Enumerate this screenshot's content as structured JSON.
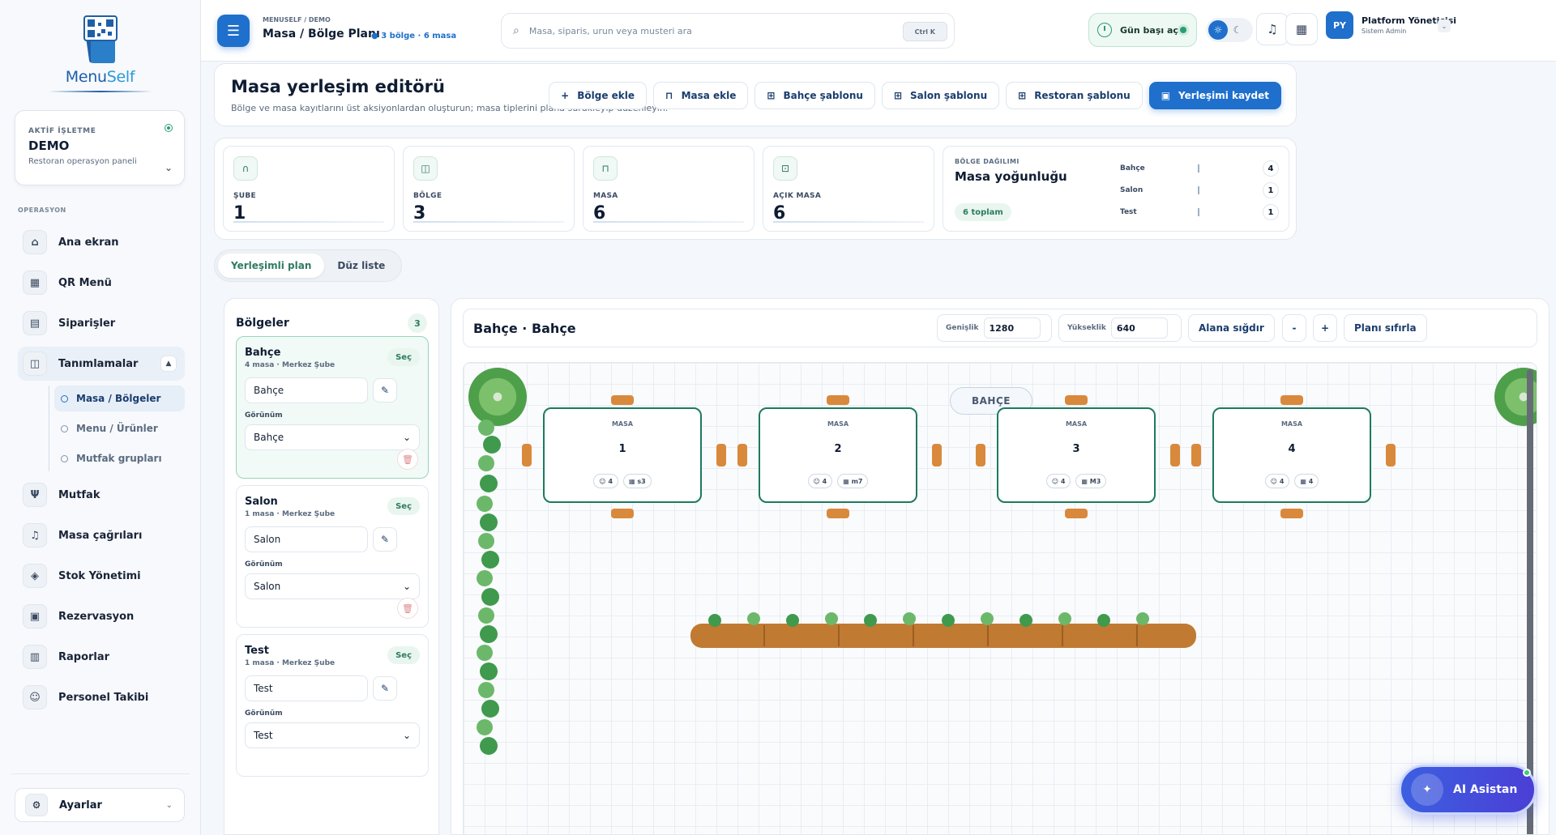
{
  "brand": {
    "name_part1": "Menu",
    "name_part2": "Self"
  },
  "business": {
    "label": "AKTİF İŞLETME",
    "name": "DEMO",
    "subtitle": "Restoran operasyon paneli"
  },
  "sidebar": {
    "section_label": "OPERASYON",
    "items": [
      {
        "label": "Ana ekran",
        "icon": "home-icon"
      },
      {
        "label": "QR Menü",
        "icon": "grid-icon"
      },
      {
        "label": "Siparişler",
        "icon": "receipt-icon"
      },
      {
        "label": "Tanımlamalar",
        "icon": "layers-icon"
      },
      {
        "label": "Mutfak",
        "icon": "utensils-icon"
      },
      {
        "label": "Masa çağrıları",
        "icon": "bell-icon"
      },
      {
        "label": "Stok Yönetimi",
        "icon": "stack-icon"
      },
      {
        "label": "Rezervasyon",
        "icon": "calendar-icon"
      },
      {
        "label": "Raporlar",
        "icon": "chart-icon"
      },
      {
        "label": "Personel Takibi",
        "icon": "users-icon"
      }
    ],
    "subitems": [
      {
        "label": "Masa / Bölgeler"
      },
      {
        "label": "Menu / Ürünler"
      },
      {
        "label": "Mutfak grupları"
      }
    ],
    "settings_label": "Ayarlar"
  },
  "topbar": {
    "breadcrumb": "MENUSELF / DEMO",
    "title": "Masa / Bölge Planı",
    "meta": "3 bölge · 6 masa",
    "search_placeholder": "Masa, siparis, urun veya musteri ara",
    "shortcut": "Ctrl K",
    "day_status": "Gün başı açık",
    "user_initials": "PY",
    "user_name": "Platform Yöneticisi",
    "user_role": "Sistem Admin"
  },
  "editor": {
    "title": "Masa yerleşim editörü",
    "subtitle": "Bölge ve masa kayıtlarını üst aksiyonlardan oluşturun; masa tiplerini plana sürükleyip düzenleyin.",
    "actions": {
      "add_region": "Bölge ekle",
      "add_table": "Masa ekle",
      "garden_template": "Bahçe şablonu",
      "salon_template": "Salon şablonu",
      "restaurant_template": "Restoran şablonu",
      "save_layout": "Yerleşimi kaydet"
    }
  },
  "stats": [
    {
      "label": "ŞUBE",
      "value": "1"
    },
    {
      "label": "BÖLGE",
      "value": "3"
    },
    {
      "label": "MASA",
      "value": "6"
    },
    {
      "label": "AÇIK MASA",
      "value": "6"
    }
  ],
  "distribution": {
    "label": "BÖLGE DAĞILIMI",
    "title": "Masa yoğunluğu",
    "total": "6 toplam",
    "rows": [
      {
        "name": "Bahçe",
        "count": "4"
      },
      {
        "name": "Salon",
        "count": "1"
      },
      {
        "name": "Test",
        "count": "1"
      }
    ]
  },
  "view_tabs": {
    "plan": "Yerleşimli plan",
    "list": "Düz liste"
  },
  "regions": {
    "title": "Bölgeler",
    "count": "3",
    "select_label": "Seç",
    "appearance_label": "Görünüm",
    "items": [
      {
        "name": "Bahçe",
        "meta": "4 masa · Merkez Şube",
        "input": "Bahçe",
        "appearance": "Bahçe"
      },
      {
        "name": "Salon",
        "meta": "1 masa · Merkez Şube",
        "input": "Salon",
        "appearance": "Salon"
      },
      {
        "name": "Test",
        "meta": "1 masa · Merkez Şube",
        "input": "Test",
        "appearance": "Test"
      }
    ]
  },
  "canvas": {
    "title": "Bahçe · Bahçe",
    "width_label": "Genişlik",
    "width_value": "1280",
    "height_label": "Yükseklik",
    "height_value": "640",
    "fit_label": "Alana sığdır",
    "zoom_out": "-",
    "zoom_in": "+",
    "reset_label": "Planı sıfırla",
    "zone_label": "BAHÇE",
    "tables": [
      {
        "label": "MASA",
        "number": "1",
        "seats": "4",
        "code": "s3"
      },
      {
        "label": "MASA",
        "number": "2",
        "seats": "4",
        "code": "m7"
      },
      {
        "label": "MASA",
        "number": "3",
        "seats": "4",
        "code": "M3"
      },
      {
        "label": "MASA",
        "number": "4",
        "seats": "4",
        "code": "4"
      }
    ]
  },
  "ai": {
    "label": "AI Asistan"
  },
  "colors": {
    "primary": "#1f6fcc",
    "accent": "#1d7a5e",
    "chair": "#d9893c"
  }
}
